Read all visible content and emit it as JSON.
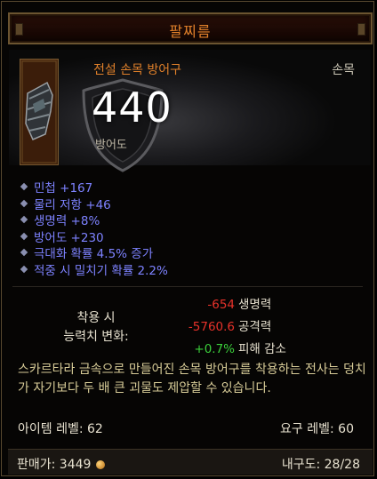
{
  "title": "팔찌름",
  "item": {
    "name": "전설 손목 방어구",
    "slot": "손목",
    "armor_value": "440",
    "armor_label": "방어도"
  },
  "properties": [
    "민첩 +167",
    "물리 저항 +46",
    "생명력 +8%",
    "방어도 +230",
    "극대화 확률 4.5% 증가",
    "적중 시 밀치기 확률 2.2%"
  ],
  "comparison": {
    "label_line1": "착용 시",
    "label_line2": "능력치 변화:",
    "rows": [
      {
        "value": "-654",
        "label": "생명력",
        "kind": "neg"
      },
      {
        "value": "-5760.6",
        "label": "공격력",
        "kind": "neg"
      },
      {
        "value": "+0.7%",
        "label": "피해 감소",
        "kind": "pos"
      }
    ]
  },
  "flavor": "스카르타라 금속으로 만들어진 손목 방어구를 착용하는 전사는 덩치가 자기보다 두 배 큰 괴물도 제압할 수 있습니다.",
  "levels": {
    "item_level": "아이템 레벨: 62",
    "required_level": "요구 레벨: 60"
  },
  "footer": {
    "sell_label": "판매가: 3449",
    "durability": "내구도: 28/28"
  },
  "icons": {
    "item": "bracer-icon",
    "armor": "shield-icon",
    "currency": "gold-coin-icon",
    "bullet": "diamond-bullet-icon"
  },
  "colors": {
    "legendary": "#e0802a",
    "magic": "#7d82ff",
    "negative": "#e8322a",
    "positive": "#3bd03b",
    "flavor": "#d8cc98"
  }
}
